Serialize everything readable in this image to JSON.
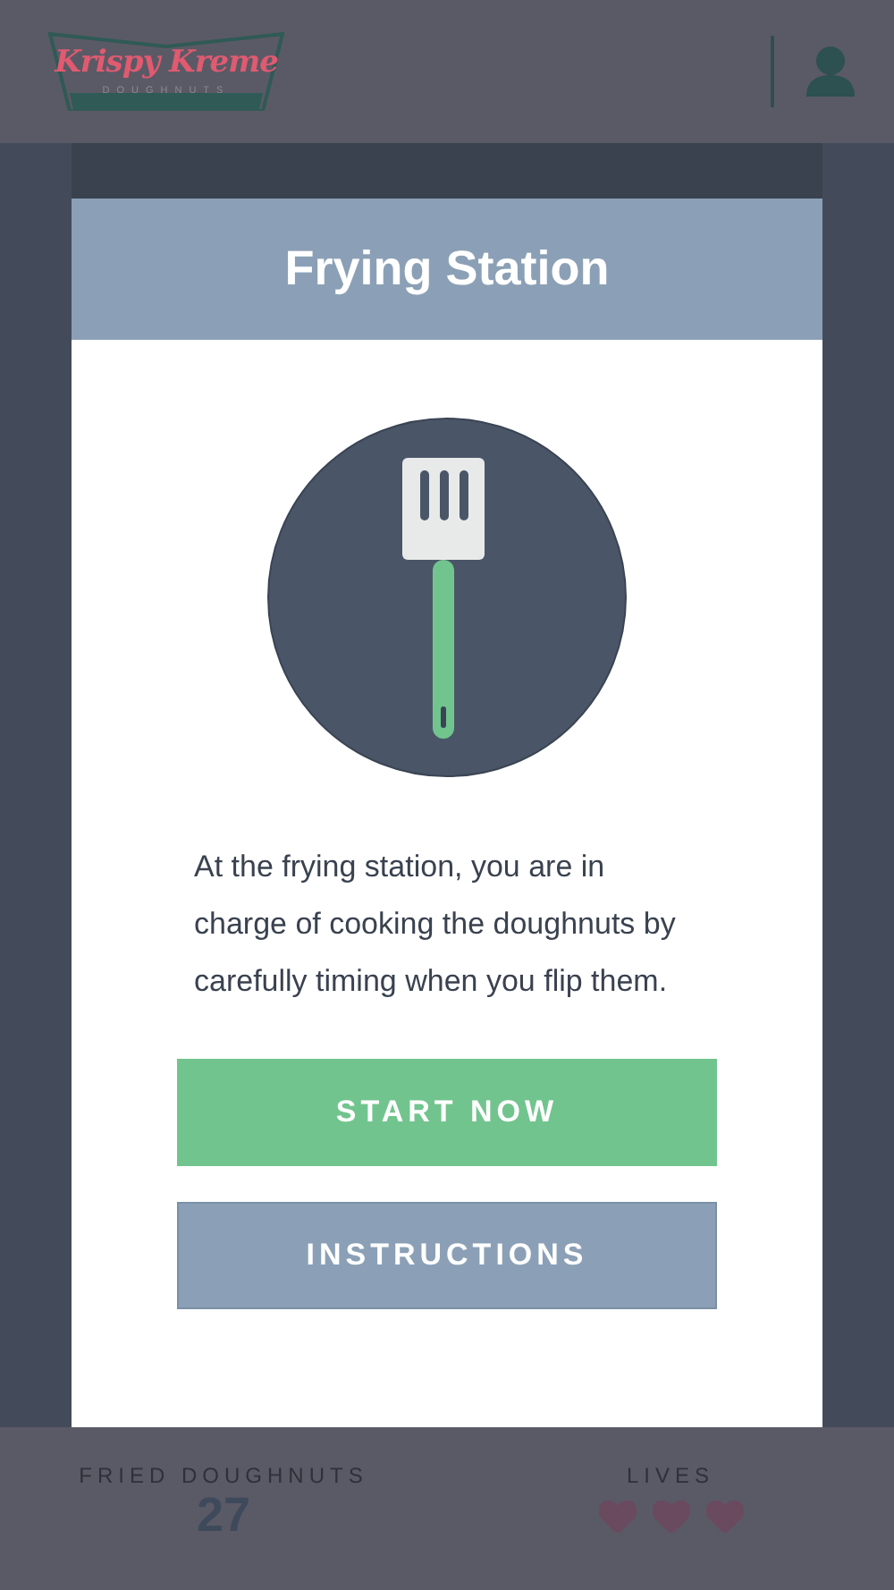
{
  "logo": {
    "name": "Krispy Kreme",
    "tagline": "DOUGHNUTS"
  },
  "modal": {
    "title": "Frying Station",
    "description": "At the frying station, you are in charge of cooking the doughnuts by carefully timing when you flip them.",
    "buttons": [
      {
        "label": "START NOW",
        "kind": "primary"
      },
      {
        "label": "INSTRUCTIONS",
        "kind": "secondary"
      }
    ]
  },
  "stats": {
    "count_label": "FRIED DOUGHNUTS",
    "count": "27",
    "lives_label": "LIVES",
    "lives": [
      {
        "filled": true
      },
      {
        "filled": true
      },
      {
        "filled": true
      }
    ]
  }
}
